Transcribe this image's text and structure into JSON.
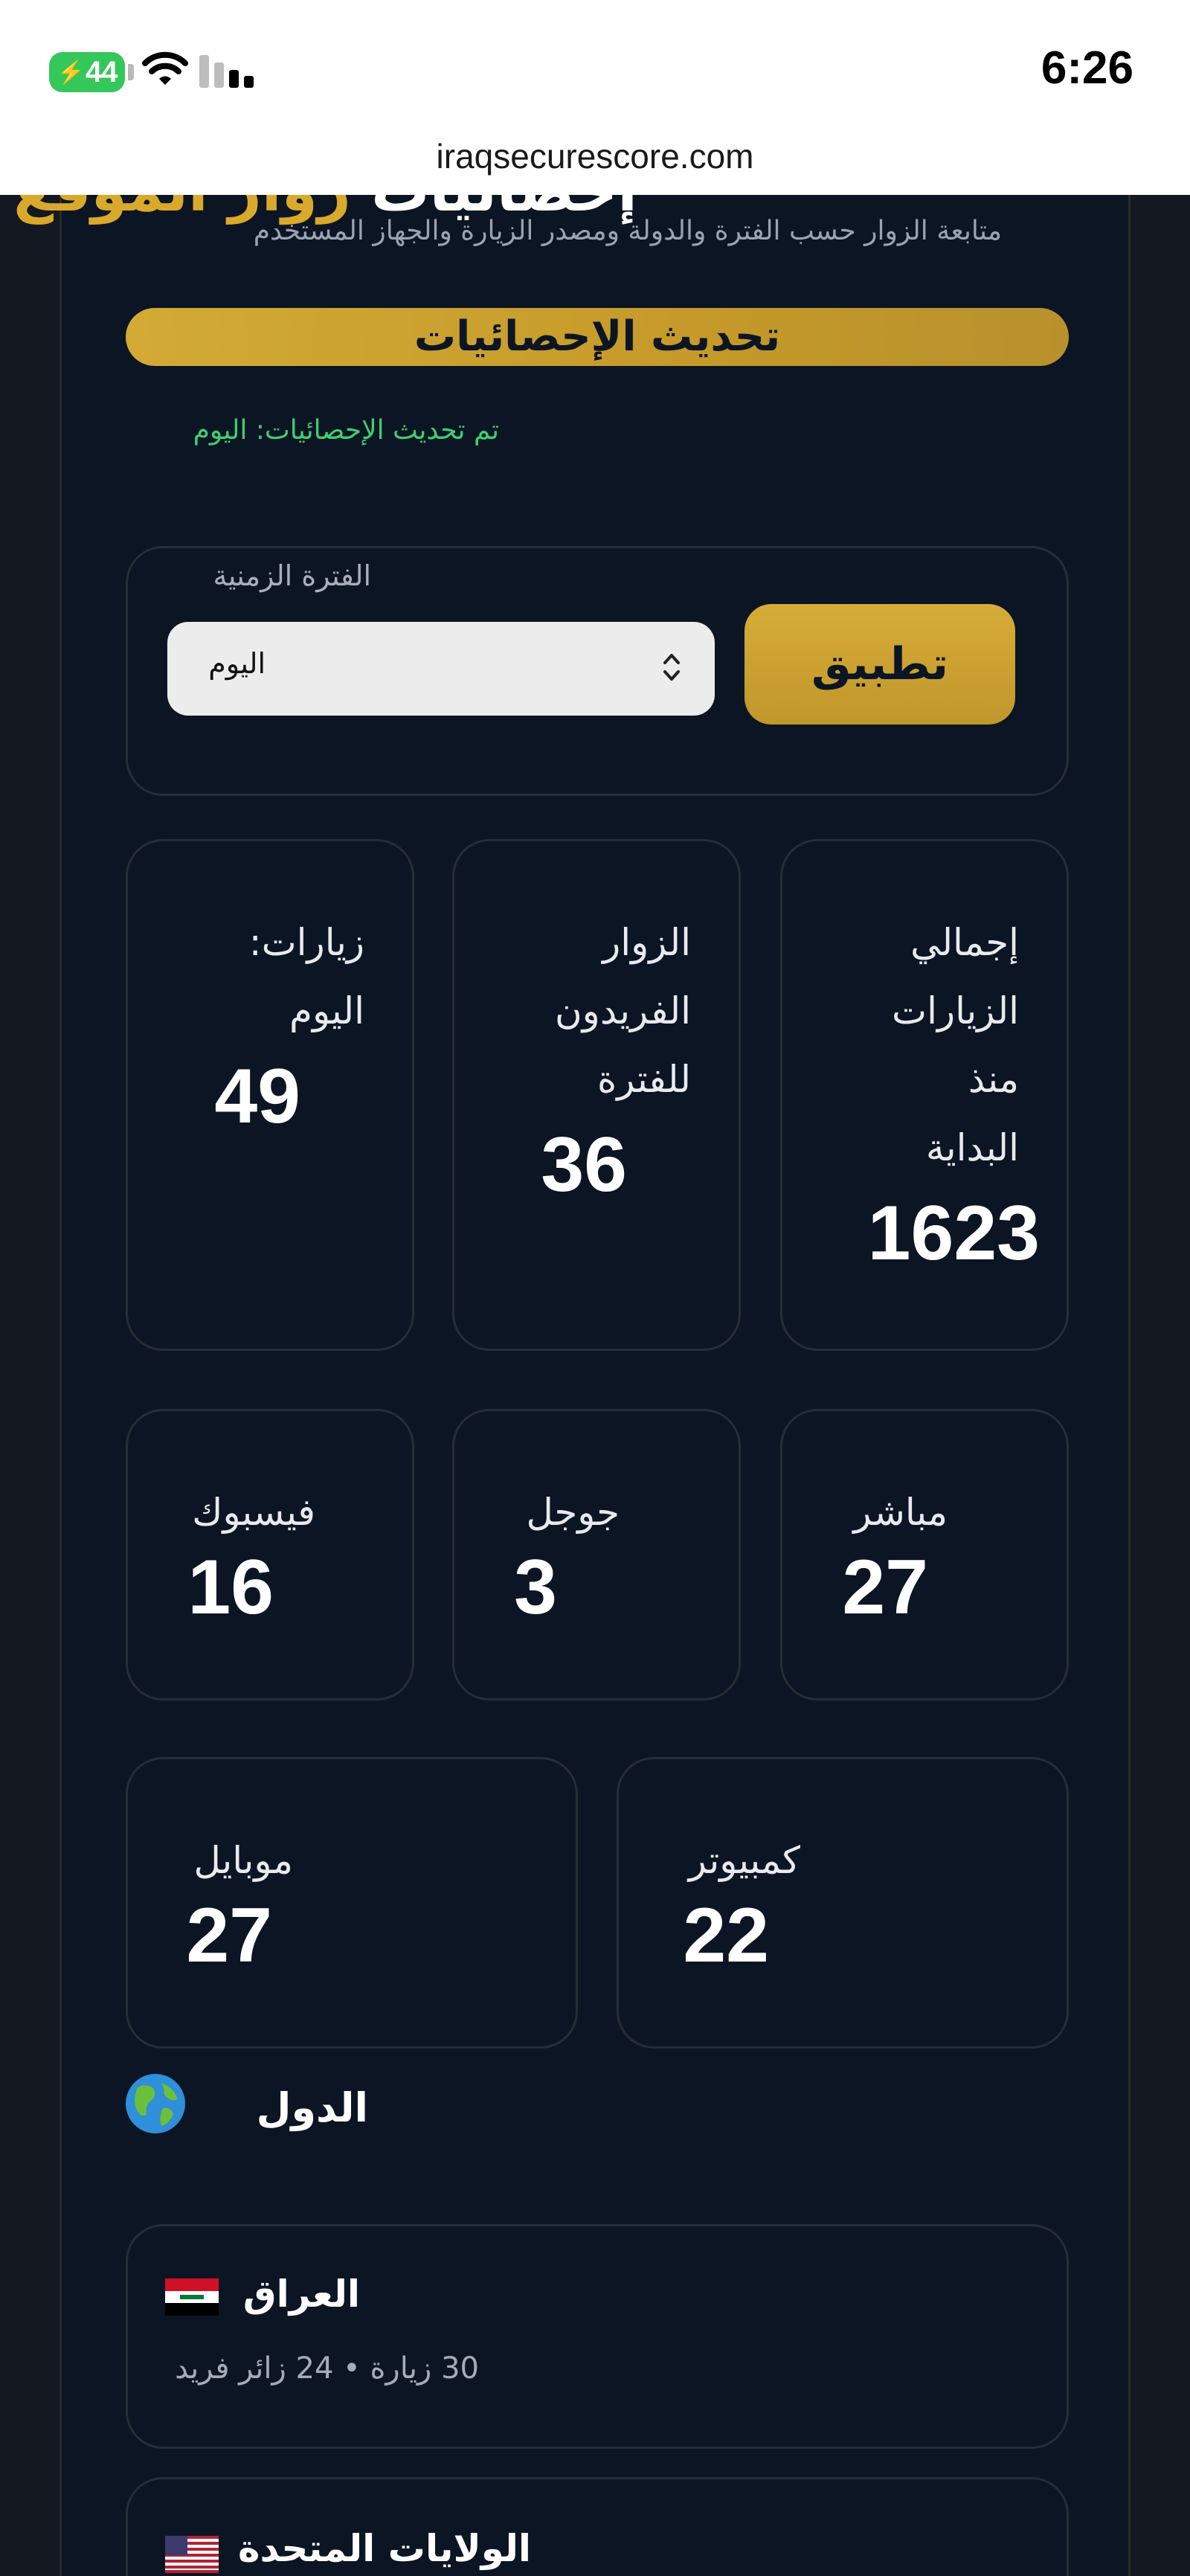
{
  "status_bar": {
    "time": "6:26",
    "battery": "44"
  },
  "browser": {
    "url": "iraqsecurescore.com"
  },
  "header": {
    "title_prefix": "إحصائيات",
    "title_highlight": "زوار الموقع",
    "subtitle": "متابعة الزوار حسب الفترة والدولة ومصدر الزيارة والجهاز المستخدم",
    "refresh_label": "تحديث الإحصائيات",
    "updated_text": "تم تحديث الإحصائيات: اليوم"
  },
  "filter": {
    "label": "الفترة الزمنية",
    "selected": "اليوم",
    "apply_label": "تطبيق"
  },
  "stats_top": [
    {
      "label_lines": [
        "إجمالي",
        "الزيارات",
        "منذ",
        "البداية"
      ],
      "value": "1623"
    },
    {
      "label_lines": [
        "الزوار",
        "الفريدون",
        "للفترة"
      ],
      "value": "36"
    },
    {
      "label_lines": [
        "زيارات:",
        "اليوم"
      ],
      "value": "49"
    }
  ],
  "stats_sources": [
    {
      "label": "مباشر",
      "value": "27"
    },
    {
      "label": "جوجل",
      "value": "3"
    },
    {
      "label": "فيسبوك",
      "value": "16"
    }
  ],
  "stats_devices": [
    {
      "label": "كمبيوتر",
      "value": "22"
    },
    {
      "label": "موبايل",
      "value": "27"
    }
  ],
  "countries_section": {
    "title": "الدول"
  },
  "countries": [
    {
      "name": "العراق",
      "meta": "30 زيارة • 24 زائر فريد"
    },
    {
      "name": "الولايات المتحدة",
      "meta": ""
    }
  ],
  "colors": {
    "accent": "#d4a733",
    "background": "#0c1524",
    "success": "#3fcf72"
  }
}
